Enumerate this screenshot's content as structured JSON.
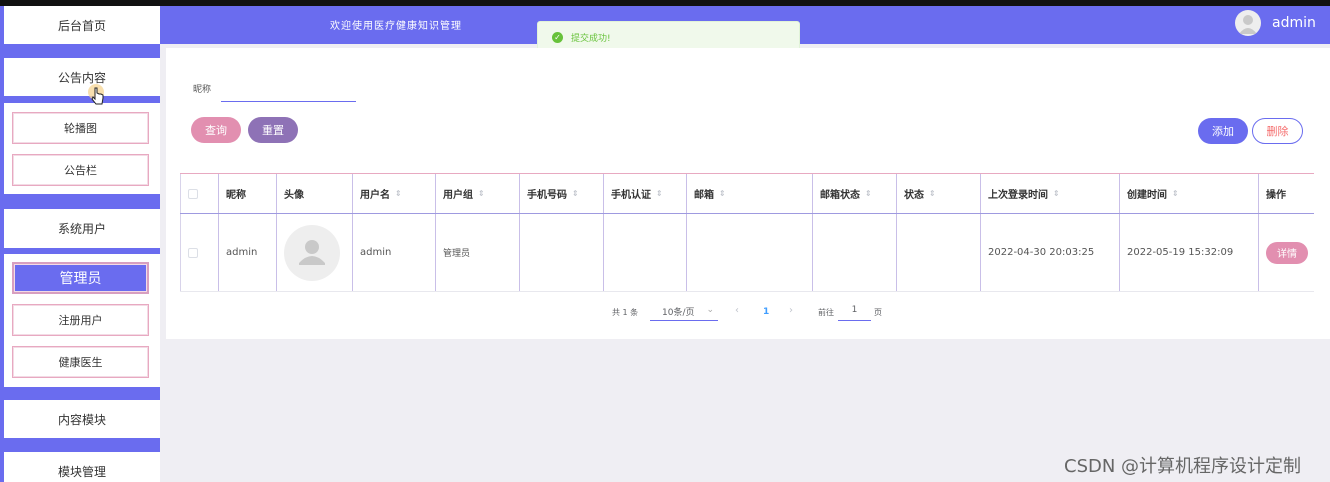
{
  "header": {
    "title": "欢迎使用医疗健康知识管理",
    "user": "admin"
  },
  "toast": {
    "message": "提交成功!"
  },
  "sidebar": {
    "sections": [
      {
        "label": "后台首页"
      },
      {
        "label": "公告内容"
      },
      {
        "label": "系统用户"
      },
      {
        "label": "内容模块"
      },
      {
        "label": "模块管理"
      }
    ],
    "sub_announce": [
      {
        "label": "轮播图"
      },
      {
        "label": "公告栏"
      }
    ],
    "sub_users": [
      {
        "label": "管理员"
      },
      {
        "label": "注册用户"
      },
      {
        "label": "健康医生"
      }
    ]
  },
  "search": {
    "label": "昵称",
    "value": "",
    "query_label": "查询",
    "reset_label": "重置"
  },
  "actions": {
    "add_label": "添加",
    "delete_label": "删除"
  },
  "table": {
    "headers": {
      "nickname": "昵称",
      "avatar": "头像",
      "username": "用户名",
      "group": "用户组",
      "phone": "手机号码",
      "phone_verify": "手机认证",
      "email": "邮箱",
      "email_status": "邮箱状态",
      "status": "状态",
      "last_login": "上次登录时间",
      "created": "创建时间",
      "ops": "操作"
    },
    "rows": [
      {
        "nickname": "admin",
        "username": "admin",
        "group": "管理员",
        "phone": "",
        "phone_verify": "",
        "email": "",
        "email_status": "",
        "status": "",
        "last_login": "2022-04-30 20:03:25",
        "created": "2022-05-19 15:32:09",
        "detail_label": "详情"
      }
    ]
  },
  "pagination": {
    "total": "共 1 条",
    "page_size": "10条/页",
    "current_page": "1",
    "goto_label": "前往",
    "goto_value": "1",
    "unit": "页"
  },
  "watermark": "CSDN @计算机程序设计定制"
}
